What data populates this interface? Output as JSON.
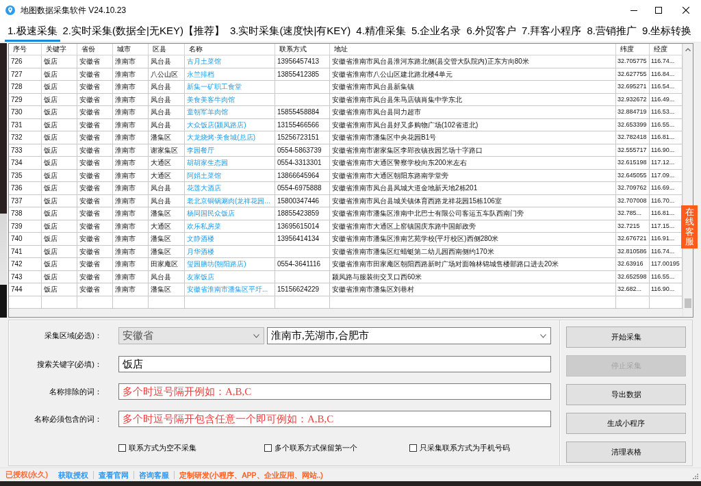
{
  "window": {
    "title": "地图数据采集软件 V24.10.23"
  },
  "tabs": [
    {
      "label": "1.极速采集",
      "selected": true
    },
    {
      "label": "2.实时采集(数据全|无KEY)【推荐】",
      "selected": false
    },
    {
      "label": "3.实时采集(速度快|有KEY)",
      "selected": false
    },
    {
      "label": "4.精准采集",
      "selected": false
    },
    {
      "label": "5.企业名录",
      "selected": false
    },
    {
      "label": "6.外贸客户",
      "selected": false
    },
    {
      "label": "7.拜客小程序",
      "selected": false
    },
    {
      "label": "8.营销推广",
      "selected": false
    },
    {
      "label": "9.坐标转换",
      "selected": false
    }
  ],
  "table": {
    "columns": [
      {
        "label": "序号",
        "kind": "text"
      },
      {
        "label": "关键字",
        "kind": "text"
      },
      {
        "label": "省份",
        "kind": "text"
      },
      {
        "label": "城市",
        "kind": "text"
      },
      {
        "label": "区县",
        "kind": "text"
      },
      {
        "label": "名称",
        "kind": "link"
      },
      {
        "label": "联系方式",
        "kind": "text"
      },
      {
        "label": "地址",
        "kind": "text"
      },
      {
        "label": "纬度",
        "kind": "coord"
      },
      {
        "label": "经度",
        "kind": "coord"
      }
    ],
    "rows": [
      [
        "726",
        "饭店",
        "安徽省",
        "淮南市",
        "凤台县",
        "古月土菜馆",
        "13956457413",
        "安徽省淮南市凤台县淮河东路北侧(县交管大队院内)正东方向80米",
        "32.705775",
        "116.74..."
      ],
      [
        "727",
        "饭店",
        "安徽省",
        "淮南市",
        "八公山区",
        "永兰排档",
        "13855412385",
        "安徽省淮南市八公山区建北路北楼4单元",
        "32.627755",
        "116.84..."
      ],
      [
        "728",
        "饭店",
        "安徽省",
        "淮南市",
        "凤台县",
        "新集一矿职工食堂",
        "",
        "安徽省淮南市凤台县新集镇",
        "32.695271",
        "116.54..."
      ],
      [
        "729",
        "饭店",
        "安徽省",
        "淮南市",
        "凤台县",
        "美食美客牛肉馆",
        "",
        "安徽省淮南市凤台县朱马店镇肖集中学东北",
        "32.932672",
        "116.49..."
      ],
      [
        "730",
        "饭店",
        "安徽省",
        "淮南市",
        "凤台县",
        "童朝军羊肉馆",
        "15855458884",
        "安徽省淮南市凤台县同力超市",
        "32.884719",
        "116.53..."
      ],
      [
        "731",
        "饭店",
        "安徽省",
        "淮南市",
        "凤台县",
        "大众饭店(颍凤路店)",
        "13155466566",
        "安徽省淮南市凤台县好又多购物广场(102省道北)",
        "32.653399",
        "116.55..."
      ],
      [
        "732",
        "饭店",
        "安徽省",
        "淮南市",
        "潘集区",
        "大龙烧烤·美食城(总店)",
        "15256723151",
        "安徽省淮南市潘集区中央花园B1号",
        "32.782418",
        "116.81..."
      ],
      [
        "733",
        "饭店",
        "安徽省",
        "淮南市",
        "谢家集区",
        "李园餐厅",
        "0554-5863739",
        "安徽省淮南市谢家集区李郢孜镇孜园艺场十字路口",
        "32.555717",
        "116.90..."
      ],
      [
        "734",
        "饭店",
        "安徽省",
        "淮南市",
        "大通区",
        "胡胡家生态园",
        "0554-3313301",
        "安徽省淮南市大通区警察学校向东200米左右",
        "32.615198",
        "117.12..."
      ],
      [
        "735",
        "饭店",
        "安徽省",
        "淮南市",
        "大通区",
        "阿娟土菜馆",
        "13866645964",
        "安徽省淮南市大通区朝阳东路南学堂旁",
        "32.645055",
        "117.09..."
      ],
      [
        "736",
        "饭店",
        "安徽省",
        "淮南市",
        "凤台县",
        "花莲大酒店",
        "0554-6975888",
        "安徽省淮南市凤台县凤城大道金地新天地2栋201",
        "32.709762",
        "116.69..."
      ],
      [
        "737",
        "饭店",
        "安徽省",
        "淮南市",
        "凤台县",
        "老北京铜锅涮肉(龙祥花园...",
        "15800347446",
        "安徽省淮南市凤台县城关镇体育西路龙祥花园15栋106室",
        "32.707008",
        "116.70..."
      ],
      [
        "738",
        "饭店",
        "安徽省",
        "淮南市",
        "潘集区",
        "杨同国民众饭店",
        "18855423859",
        "安徽省淮南市潘集区淮南中北巴士有限公司客运五车队西南门旁",
        "32.785...",
        "116.81..."
      ],
      [
        "739",
        "饭店",
        "安徽省",
        "淮南市",
        "大通区",
        "欢乐私房菜",
        "13695615014",
        "安徽省淮南市大通区上窑镇国庆东路中国邮政旁",
        "32.7215",
        "117.15..."
      ],
      [
        "740",
        "饭店",
        "安徽省",
        "淮南市",
        "潘集区",
        "文静酒楼",
        "13956414134",
        "安徽省淮南市潘集区淮南艺苑学校(平圩校区)西侧280米",
        "32.676721",
        "116.91..."
      ],
      [
        "741",
        "饭店",
        "安徽省",
        "淮南市",
        "潘集区",
        "月华酒楼",
        "",
        "安徽省淮南市潘集区红蜻蜓第二幼儿园西南侧约170米",
        "32.810586",
        "116.74..."
      ],
      [
        "742",
        "饭店",
        "安徽省",
        "淮南市",
        "田家庵区",
        "玺园膳坊(朝阳路店)",
        "0554-3641116",
        "安徽省淮南市田家庵区朝阳西路新时广场对面翰林锦城售楼部路口进去20米",
        "32.63916",
        "117.00195"
      ],
      [
        "743",
        "饭店",
        "安徽省",
        "淮南市",
        "凤台县",
        "友家饭店",
        "",
        "颍凤路与服装街交叉口西60米",
        "32.652598",
        "116.55..."
      ],
      [
        "744",
        "饭店",
        "安徽省",
        "淮南市",
        "潘集区",
        "安徽省淮南市潘集区平圩...",
        "15156624229",
        "安徽省淮南市潘集区刘巷村",
        "32.682...",
        "116.90..."
      ]
    ]
  },
  "search_form": {
    "region": {
      "label": "采集区域(必选)：",
      "province": {
        "value": "安徽省",
        "kind": "list"
      },
      "cities": {
        "value": "淮南市,芜湖市,合肥市",
        "kind": "editable"
      }
    },
    "keyword": {
      "label": "搜索关键字(必填)：",
      "value": "饭店"
    },
    "exclude": {
      "label": "名称排除的词：",
      "placeholder": "多个时逗号隔开例如：A,B,C"
    },
    "include": {
      "label": "名称必须包含的词：",
      "placeholder": "多个时逗号隔开包含任意一个即可例如：A,B,C"
    },
    "options": [
      {
        "label": "联系方式为空不采集",
        "checked": false
      },
      {
        "label": "多个联系方式保留第一个",
        "checked": false
      },
      {
        "label": "只采集联系方式为手机号码",
        "checked": false
      }
    ]
  },
  "actions": [
    {
      "label": "开始采集",
      "disabled": false
    },
    {
      "label": "停止采集",
      "disabled": true
    },
    {
      "label": "导出数据",
      "disabled": false
    },
    {
      "label": "生成小程序",
      "disabled": false
    },
    {
      "label": "清理表格",
      "disabled": false
    }
  ],
  "side_tab": {
    "label": "在线客服"
  },
  "status_bar": {
    "license": {
      "text": "已授权(永久)",
      "color": "#ff6633"
    },
    "links": [
      {
        "text": "获取授权",
        "color": "#2b95f0"
      },
      {
        "text": "查看官网",
        "color": "#2b95f0"
      },
      {
        "text": "咨询客服",
        "color": "#2b95f0"
      },
      {
        "text": "定制研发(小程序、APP、企业应用、网站..)",
        "color": "#ff5a1a"
      }
    ]
  }
}
